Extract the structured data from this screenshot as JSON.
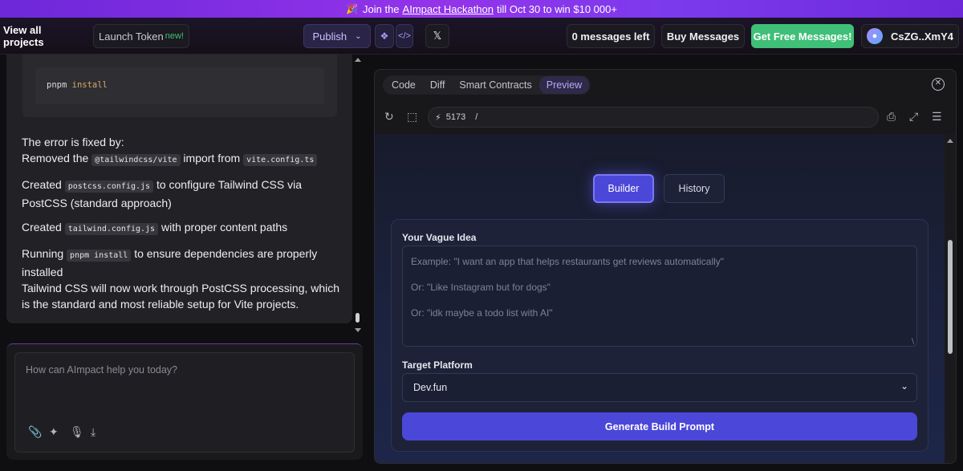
{
  "banner": {
    "prefix": "Join the",
    "link": "AImpact Hackathon",
    "suffix": "till Oct 30 to win $10 000+"
  },
  "topbar": {
    "view_all": "View all projects",
    "launch_token": "Launch Token",
    "new_tag": "new!",
    "publish": "Publish",
    "messages_left": "0 messages left",
    "buy_messages": "Buy Messages",
    "get_free": "Get Free Messages!",
    "wallet": "CsZG..XmY4"
  },
  "chat": {
    "code_cmd": "pnpm",
    "code_arg": "install",
    "fix_intro": "The error is fixed by:",
    "removed_pre": "Removed the",
    "removed_code": "@tailwindcss/vite",
    "removed_mid": "import from",
    "removed_file": "vite.config.ts",
    "created1_pre": "Created",
    "created1_code": "postcss.config.js",
    "created1_post": "to configure Tailwind CSS via PostCSS (standard approach)",
    "created2_pre": "Created",
    "created2_code": "tailwind.config.js",
    "created2_post": "with proper content paths",
    "running_pre": "Running",
    "running_code": "pnpm install",
    "running_post": "to ensure dependencies are properly installed",
    "final": "Tailwind CSS will now work through PostCSS processing, which is the standard and most reliable setup for Vite projects."
  },
  "composer": {
    "placeholder": "How can AImpact help you today?"
  },
  "preview": {
    "tabs": [
      "Code",
      "Diff",
      "Smart Contracts",
      "Preview"
    ],
    "active_tab": "Preview",
    "port": "5173",
    "path": "/",
    "builder": "Builder",
    "history": "History",
    "idea_label": "Your Vague Idea",
    "idea_placeholders": [
      "Example: \"I want an app that helps restaurants get reviews automatically\"",
      "Or: \"Like Instagram but for dogs\"",
      "Or: \"idk maybe a todo list with AI\""
    ],
    "platform_label": "Target Platform",
    "platform_value": "Dev.fun",
    "generate": "Generate Build Prompt"
  }
}
